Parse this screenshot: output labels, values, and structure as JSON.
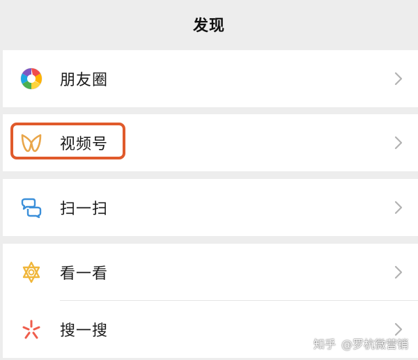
{
  "header": {
    "title": "发现"
  },
  "groups": [
    {
      "items": [
        {
          "label": "朋友圈",
          "icon": "moments-icon"
        }
      ]
    },
    {
      "items": [
        {
          "label": "视频号",
          "icon": "channels-icon"
        }
      ]
    },
    {
      "items": [
        {
          "label": "扫一扫",
          "icon": "scan-icon"
        }
      ]
    },
    {
      "items": [
        {
          "label": "看一看",
          "icon": "top-stories-icon"
        },
        {
          "label": "搜一搜",
          "icon": "search-icon"
        }
      ]
    }
  ],
  "watermark": {
    "brand": "知乎",
    "author": "@罗杭微营销"
  },
  "colors": {
    "highlight": "#e05a2b",
    "background": "#ededed",
    "row": "#ffffff",
    "channels": "#e9a64a",
    "scan": "#3b8fd9",
    "top_stories": "#f0b63a",
    "search": "#ef5d4c"
  }
}
